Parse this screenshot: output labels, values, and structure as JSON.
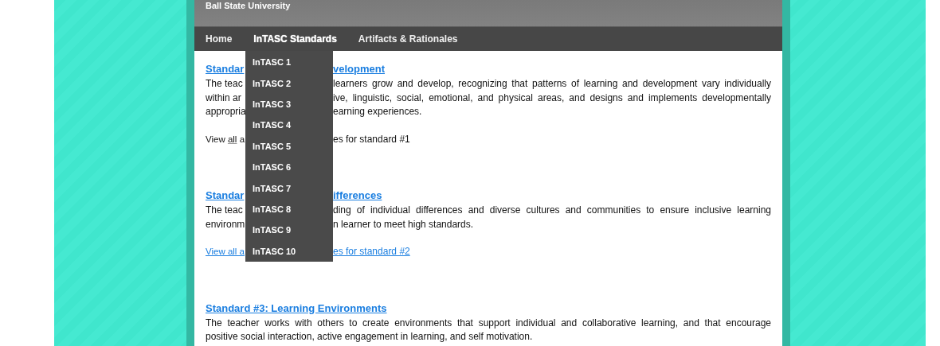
{
  "header": {
    "title": "Ball State University"
  },
  "nav": [
    {
      "label": "Home",
      "selected": false
    },
    {
      "label": "InTASC Standards",
      "selected": true
    },
    {
      "label": "Artifacts & Rationales",
      "selected": false
    }
  ],
  "dropdown": [
    "InTASC 1",
    "InTASC 2",
    "InTASC 3",
    "InTASC 4",
    "InTASC 5",
    "InTASC 6",
    "InTASC 7",
    "InTASC 8",
    "InTASC 9",
    "InTASC 10"
  ],
  "standards": [
    {
      "title": [
        "Standar",
        "velopment"
      ],
      "paragraph": [
        [
          "The teac",
          "learners grow and develop, recognizing that patterns of learning and development vary individually"
        ],
        [
          "within ar",
          "ive, linguistic, social, emotional, and physical areas, and designs and implements developmentally"
        ],
        [
          "appropria",
          "earning experiences."
        ]
      ],
      "view": {
        "kind": "text",
        "parts": [
          "View ",
          "all",
          " a",
          "es for standard #1"
        ]
      }
    },
    {
      "title": [
        "Standar",
        "ifferences"
      ],
      "paragraph": [
        [
          "The teac",
          "ding of individual differences and diverse cultures and communities to ensure inclusive learning"
        ],
        [
          "environm",
          "n learner to meet high standards."
        ]
      ],
      "view": {
        "kind": "link",
        "parts": [
          "View all a",
          "es for standard #2"
        ]
      }
    },
    {
      "title": [
        "Standard #3: Learning Environments"
      ],
      "paragraph": [
        [
          "The teacher works with others to create environments that support individual and collaborative learning, and that encourage"
        ],
        [
          "positive social interaction, active engagement in learning, and self motivation."
        ]
      ]
    }
  ]
}
